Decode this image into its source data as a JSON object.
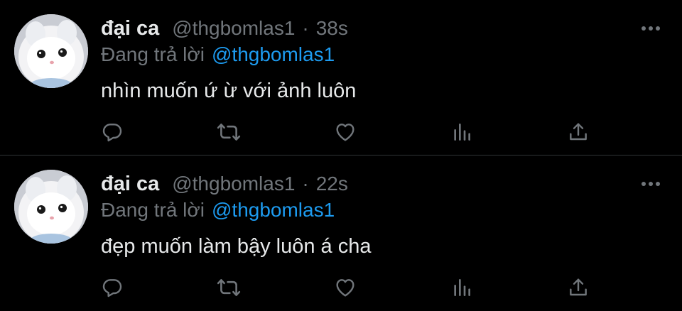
{
  "tweets": [
    {
      "author_name": "đại ca",
      "handle": "@thgbomlas1",
      "separator": "·",
      "time": "38s",
      "reply_prefix": "Đang trả lời",
      "reply_to": "@thgbomlas1",
      "text": "nhìn muốn ứ ừ với ảnh luôn"
    },
    {
      "author_name": "đại ca",
      "handle": "@thgbomlas1",
      "separator": "·",
      "time": "22s",
      "reply_prefix": "Đang trả lời",
      "reply_to": "@thgbomlas1",
      "text": "đẹp muốn làm bậy luôn á cha"
    }
  ],
  "icons": {
    "more": "more-dots-icon",
    "reply": "reply-icon",
    "retweet": "retweet-icon",
    "like": "heart-icon",
    "stats": "analytics-icon",
    "share": "share-icon"
  },
  "colors": {
    "background": "#000000",
    "text": "#e7e9ea",
    "muted": "#71767b",
    "accent": "#1d9bf0",
    "divider": "#2f3336"
  }
}
